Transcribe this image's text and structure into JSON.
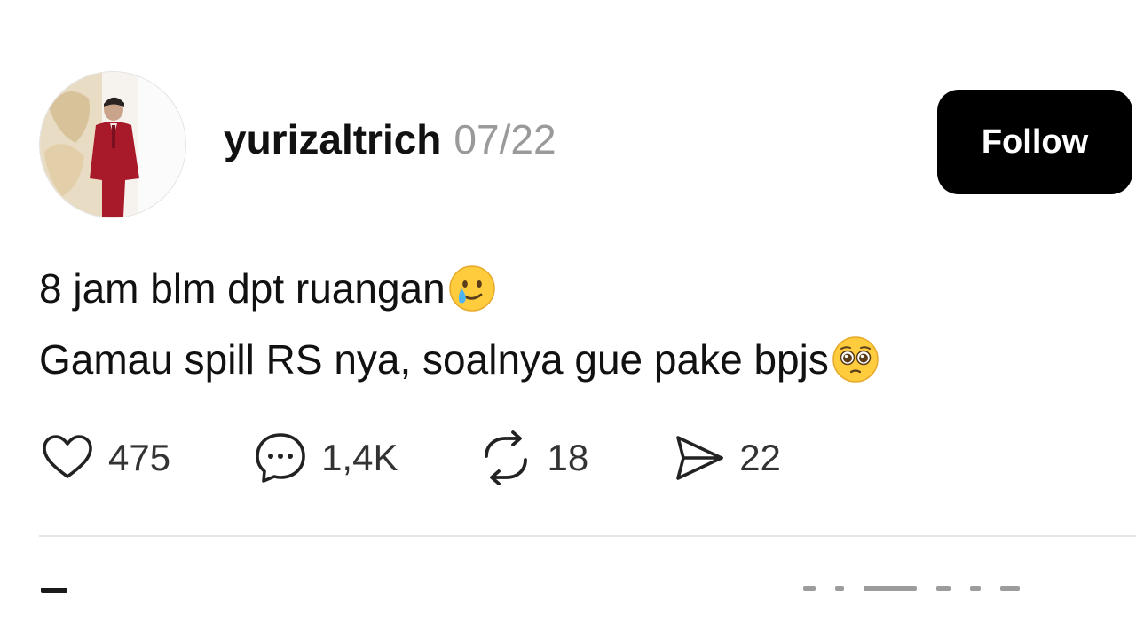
{
  "post": {
    "author": {
      "username": "yurizaltrich",
      "date": "07/22"
    },
    "follow_label": "Follow",
    "lines": [
      "8 jam blm dpt ruangan",
      "Gamau spill RS nya, soalnya gue pake bpjs"
    ],
    "line_emojis": [
      "smiling-face-with-tear",
      "pleading-face"
    ],
    "stats": {
      "likes": "475",
      "comments": "1,4K",
      "reposts": "18",
      "shares": "22"
    },
    "icons": {
      "like": "heart-icon",
      "comment": "comment-bubble-icon",
      "repost": "repost-icon",
      "share": "send-icon"
    },
    "colors": {
      "follow_button_bg": "#000000",
      "follow_button_text": "#ffffff",
      "date_text": "#9a9a9a",
      "divider": "#e6e6e6"
    }
  }
}
